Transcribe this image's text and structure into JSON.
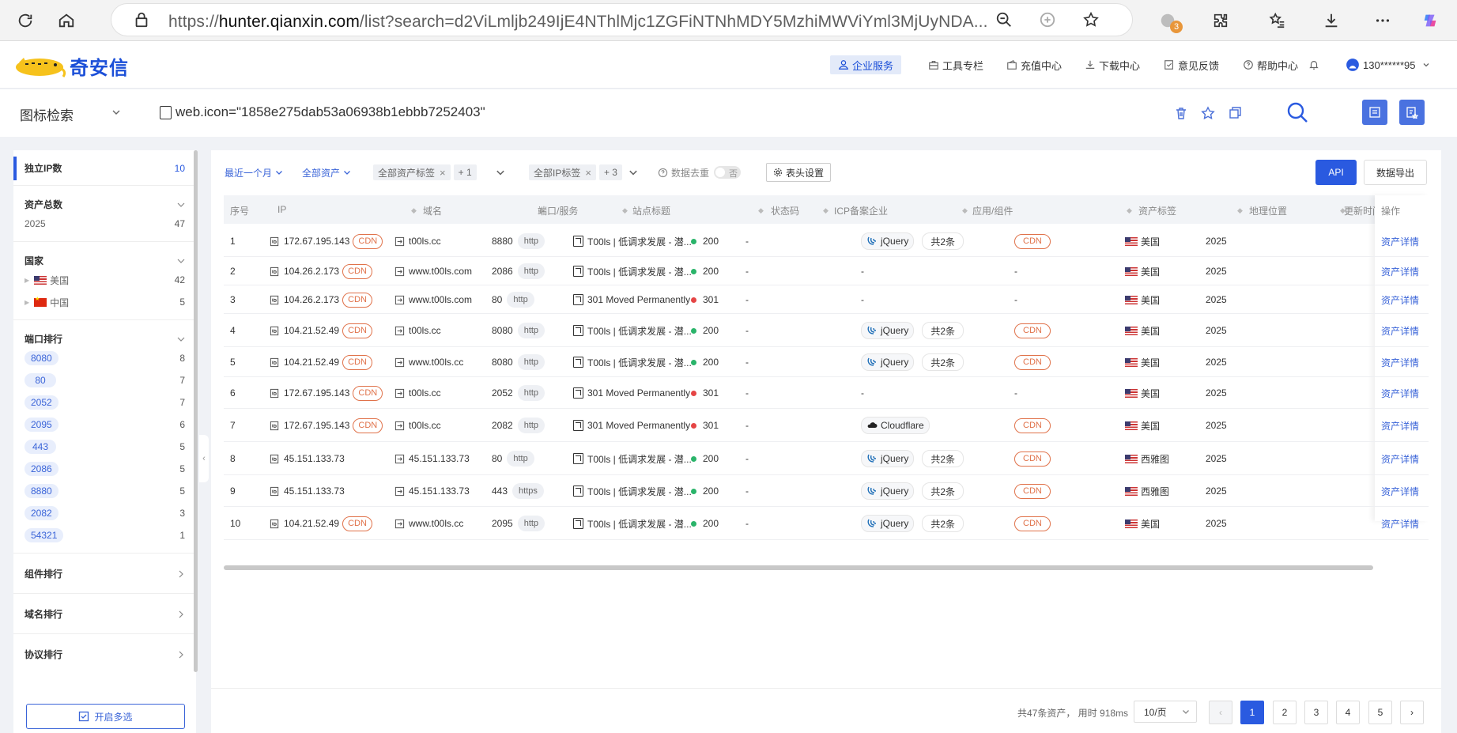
{
  "browser": {
    "url_prefix": "https://",
    "url_host": "hunter.qianxin.com",
    "url_rest": "/list?search=d2ViLmljb249IjE4NThlMjc1ZGFiNTNhMDY5MzhiMWViYml3MjUyNDA...",
    "extension_badge": "3"
  },
  "header": {
    "logo_text": "奇安信",
    "nav": [
      "企业服务",
      "工具专栏",
      "充值中心",
      "下载中心",
      "意见反馈",
      "帮助中心"
    ],
    "user": "130******95"
  },
  "search": {
    "type_label": "图标检索",
    "query": "web.icon=\"1858e275dab53a06938b1ebbb7252403\""
  },
  "sidebar": {
    "unique_ip_label": "独立IP数",
    "unique_ip_count": "10",
    "assets_total_label": "资产总数",
    "assets_year": "2025",
    "assets_year_count": "47",
    "country_label": "国家",
    "countries": [
      {
        "name": "美国",
        "count": "42"
      },
      {
        "name": "中国",
        "count": "5"
      }
    ],
    "port_label": "端口排行",
    "ports": [
      {
        "port": "8080",
        "count": "8"
      },
      {
        "port": "80",
        "count": "7"
      },
      {
        "port": "2052",
        "count": "7"
      },
      {
        "port": "2095",
        "count": "6"
      },
      {
        "port": "443",
        "count": "5"
      },
      {
        "port": "2086",
        "count": "5"
      },
      {
        "port": "8880",
        "count": "5"
      },
      {
        "port": "2082",
        "count": "3"
      },
      {
        "port": "54321",
        "count": "1"
      }
    ],
    "component_rank": "组件排行",
    "domain_rank": "域名排行",
    "protocol_rank": "协议排行",
    "multi_select": "开启多选"
  },
  "filters": {
    "time": "最近一个月",
    "assets": "全部资产",
    "asset_tag": "全部资产标签",
    "asset_tag_more": "+ 1",
    "ip_tag": "全部IP标签",
    "ip_tag_more": "+ 3",
    "dedupe_label": "数据去重",
    "dedupe_value": "否",
    "header_settings": "表头设置",
    "api": "API",
    "export": "数据导出"
  },
  "table": {
    "headers": [
      "序号",
      "IP",
      "域名",
      "端口/服务",
      "站点标题",
      "状态码",
      "ICP备案企业",
      "应用/组件",
      "资产标签",
      "地理位置",
      "更新时间",
      "操作"
    ],
    "rows": [
      {
        "no": "1",
        "ip": "172.67.195.143",
        "cdn": "CDN",
        "domain": "t00ls.cc",
        "port": "8880",
        "svc": "http",
        "title": "T00ls | 低调求发展 - 潜...",
        "status": "200",
        "icp": "-",
        "comp": "jQuery",
        "more": "共2条",
        "tag": "CDN",
        "geo": "美国",
        "time": "2025",
        "action": "资产详情"
      },
      {
        "no": "2",
        "ip": "104.26.2.173",
        "cdn": "CDN",
        "domain": "www.t00ls.com",
        "port": "2086",
        "svc": "http",
        "title": "T00ls | 低调求发展 - 潜...",
        "status": "200",
        "icp": "-",
        "comp": "-",
        "more": "",
        "tag": "-",
        "geo": "美国",
        "time": "2025",
        "action": "资产详情"
      },
      {
        "no": "3",
        "ip": "104.26.2.173",
        "cdn": "CDN",
        "domain": "www.t00ls.com",
        "port": "80",
        "svc": "http",
        "title": "301 Moved Permanently",
        "status": "301",
        "icp": "-",
        "comp": "-",
        "more": "",
        "tag": "-",
        "geo": "美国",
        "time": "2025",
        "action": "资产详情"
      },
      {
        "no": "4",
        "ip": "104.21.52.49",
        "cdn": "CDN",
        "domain": "t00ls.cc",
        "port": "8080",
        "svc": "http",
        "title": "T00ls | 低调求发展 - 潜...",
        "status": "200",
        "icp": "-",
        "comp": "jQuery",
        "more": "共2条",
        "tag": "CDN",
        "geo": "美国",
        "time": "2025",
        "action": "资产详情"
      },
      {
        "no": "5",
        "ip": "104.21.52.49",
        "cdn": "CDN",
        "domain": "www.t00ls.cc",
        "port": "8080",
        "svc": "http",
        "title": "T00ls | 低调求发展 - 潜...",
        "status": "200",
        "icp": "-",
        "comp": "jQuery",
        "more": "共2条",
        "tag": "CDN",
        "geo": "美国",
        "time": "2025",
        "action": "资产详情"
      },
      {
        "no": "6",
        "ip": "172.67.195.143",
        "cdn": "CDN",
        "domain": "t00ls.cc",
        "port": "2052",
        "svc": "http",
        "title": "301 Moved Permanently",
        "status": "301",
        "icp": "-",
        "comp": "-",
        "more": "",
        "tag": "-",
        "geo": "美国",
        "time": "2025",
        "action": "资产详情"
      },
      {
        "no": "7",
        "ip": "172.67.195.143",
        "cdn": "CDN",
        "domain": "t00ls.cc",
        "port": "2082",
        "svc": "http",
        "title": "301 Moved Permanently",
        "status": "301",
        "icp": "-",
        "comp": "Cloudflare",
        "more": "",
        "tag": "CDN",
        "geo": "美国",
        "time": "2025",
        "action": "资产详情"
      },
      {
        "no": "8",
        "ip": "45.151.133.73",
        "cdn": "",
        "domain": "45.151.133.73",
        "port": "80",
        "svc": "http",
        "title": "T00ls | 低调求发展 - 潜...",
        "status": "200",
        "icp": "-",
        "comp": "jQuery",
        "more": "共2条",
        "tag": "CDN",
        "geo": "西雅图",
        "time": "2025",
        "action": "资产详情"
      },
      {
        "no": "9",
        "ip": "45.151.133.73",
        "cdn": "",
        "domain": "45.151.133.73",
        "port": "443",
        "svc": "https",
        "title": "T00ls | 低调求发展 - 潜...",
        "status": "200",
        "icp": "-",
        "comp": "jQuery",
        "more": "共2条",
        "tag": "CDN",
        "geo": "西雅图",
        "time": "2025",
        "action": "资产详情"
      },
      {
        "no": "10",
        "ip": "104.21.52.49",
        "cdn": "CDN",
        "domain": "www.t00ls.cc",
        "port": "2095",
        "svc": "http",
        "title": "T00ls | 低调求发展 - 潜...",
        "status": "200",
        "icp": "-",
        "comp": "jQuery",
        "more": "共2条",
        "tag": "CDN",
        "geo": "美国",
        "time": "2025",
        "action": "资产详情"
      }
    ]
  },
  "footer": {
    "total": "共47条资产， 用时 918ms",
    "page_size": "10/页",
    "pages": [
      "1",
      "2",
      "3",
      "4",
      "5"
    ]
  },
  "colors": {
    "primary": "#2a5ae0",
    "cdn": "#e0724a",
    "ok": "#2ab46a",
    "redirect": "#e54545"
  }
}
